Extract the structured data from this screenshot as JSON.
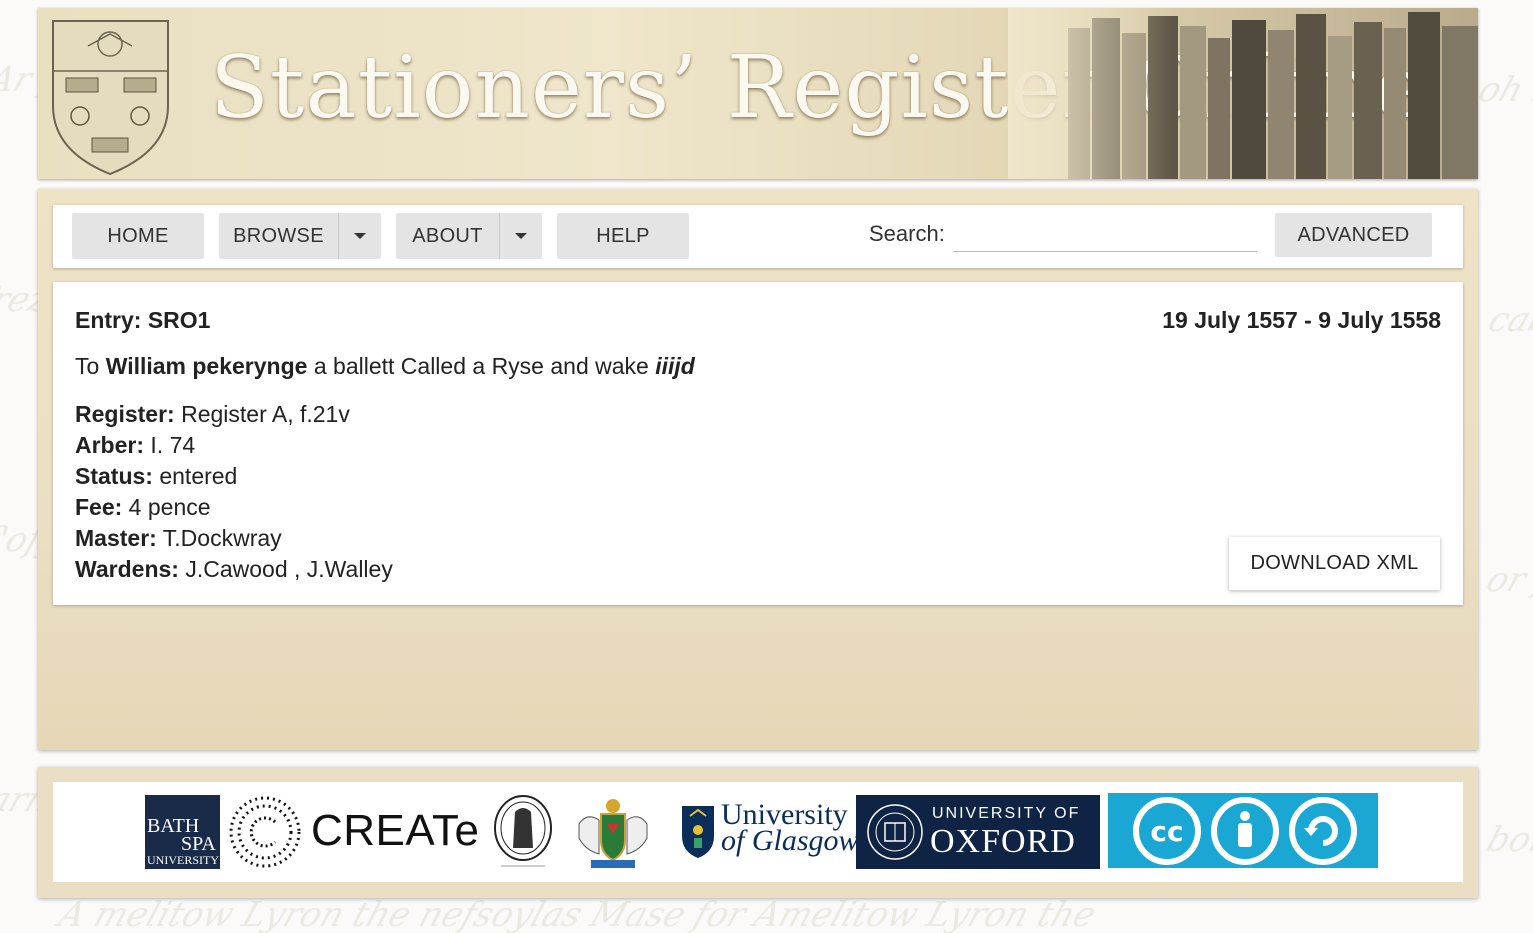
{
  "banner": {
    "title": "Stationers’ Register Online"
  },
  "nav": {
    "home": "HOME",
    "browse": "BROWSE",
    "about": "ABOUT",
    "help": "HELP",
    "search_label": "Search:",
    "search_value": "",
    "advanced": "ADVANCED"
  },
  "entry": {
    "id_label": "Entry: SRO1",
    "date_range": "19 July 1557 - 9 July 1558",
    "text_prefix": "To ",
    "text_name": "William pekerynge",
    "text_middle": " a ballett Called a Ryse and wake ",
    "text_fee": "iiijd",
    "fields": {
      "register_label": "Register:",
      "register_value": " Register A, f.21v",
      "arber_label": "Arber:",
      "arber_value": " I. 74",
      "status_label": "Status:",
      "status_value": " entered",
      "fee_label": "Fee:",
      "fee_value": " 4 pence",
      "master_label": "Master:",
      "master_value": " T.Dockwray",
      "wardens_label": "Wardens:",
      "wardens_value": " J.Cawood , J.Walley"
    },
    "download": "DOWNLOAD XML"
  },
  "footer": {
    "bathspa_1": "BATH",
    "bathspa_2": "SPA",
    "bathspa_3": "UNIVERSITY",
    "create": "CREATe",
    "glasgow_1": "University",
    "glasgow_2": "of Glasgow",
    "oxford_1": "UNIVERSITY OF",
    "oxford_2": "OXFORD"
  },
  "colors": {
    "parchment": "#eadfc4",
    "oxford_blue": "#0f2344",
    "cc_blue": "#1aa7d3"
  }
}
